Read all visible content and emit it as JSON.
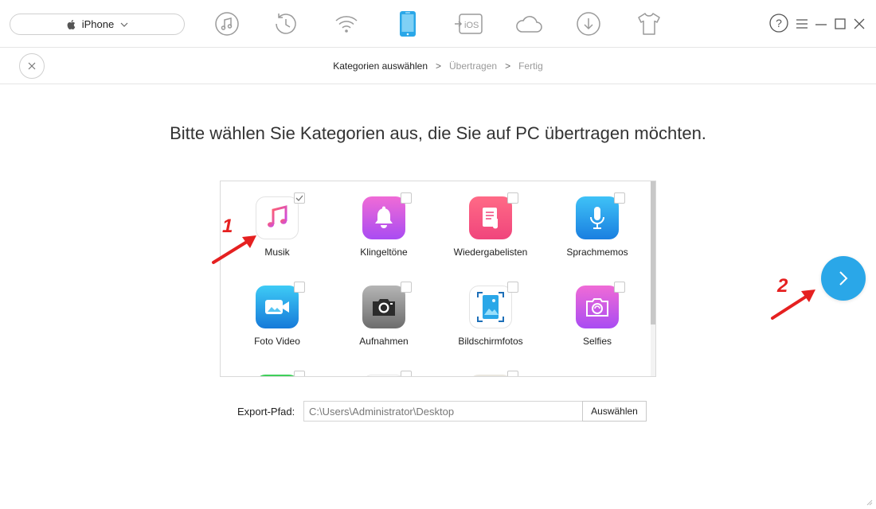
{
  "toolbar": {
    "device": {
      "name": "iPhone",
      "icon": "apple-icon",
      "dropdown_icon": "chevron-down-icon"
    },
    "tools": [
      {
        "id": "music",
        "icon": "music-note-icon"
      },
      {
        "id": "history",
        "icon": "history-clock-icon"
      },
      {
        "id": "wifi",
        "icon": "wifi-icon"
      },
      {
        "id": "phone",
        "icon": "phone-icon",
        "active": true
      },
      {
        "id": "ios",
        "icon": "ios-transfer-icon",
        "label": "iOS"
      },
      {
        "id": "cloud",
        "icon": "cloud-icon"
      },
      {
        "id": "download",
        "icon": "download-icon"
      },
      {
        "id": "tshirt",
        "icon": "tshirt-icon"
      }
    ],
    "window": {
      "help": "?"
    }
  },
  "breadcrumb": {
    "steps": [
      "Kategorien auswählen",
      "Übertragen",
      "Fertig"
    ],
    "separator": ">"
  },
  "main": {
    "title": "Bitte wählen Sie Kategorien aus, die Sie auf PC übertragen möchten.",
    "categories": [
      {
        "label": "Musik",
        "icon": "music-icon",
        "checked": true
      },
      {
        "label": "Klingeltöne",
        "icon": "bell-icon",
        "checked": false
      },
      {
        "label": "Wiedergabelisten",
        "icon": "playlist-icon",
        "checked": false
      },
      {
        "label": "Sprachmemos",
        "icon": "microphone-icon",
        "checked": false
      },
      {
        "label": "Foto Video",
        "icon": "video-camera-icon",
        "checked": false
      },
      {
        "label": "Aufnahmen",
        "icon": "camera-icon",
        "checked": false
      },
      {
        "label": "Bildschirmfotos",
        "icon": "screenshot-icon",
        "checked": false
      },
      {
        "label": "Selfies",
        "icon": "selfie-camera-icon",
        "checked": false
      }
    ],
    "export": {
      "label": "Export-Pfad:",
      "path": "C:\\Users\\Administrator\\Desktop",
      "button": "Auswählen"
    },
    "next_icon": "chevron-right-icon"
  },
  "annotations": [
    "1",
    "2"
  ],
  "colors": {
    "accent": "#2aa7e8",
    "annotation": "#e52020",
    "bell_gradient": [
      "#f06bd6",
      "#a94cf2"
    ],
    "playlist_gradient": [
      "#ff6a86",
      "#f0457c"
    ],
    "mic_gradient": [
      "#3fc2f7",
      "#1a7fe0"
    ],
    "video_gradient": [
      "#3ecbf6",
      "#167ad9"
    ],
    "camera_gradient": [
      "#b5b5b5",
      "#6d6d6d"
    ],
    "selfie_gradient": [
      "#f06bd6",
      "#a94cf2"
    ]
  }
}
